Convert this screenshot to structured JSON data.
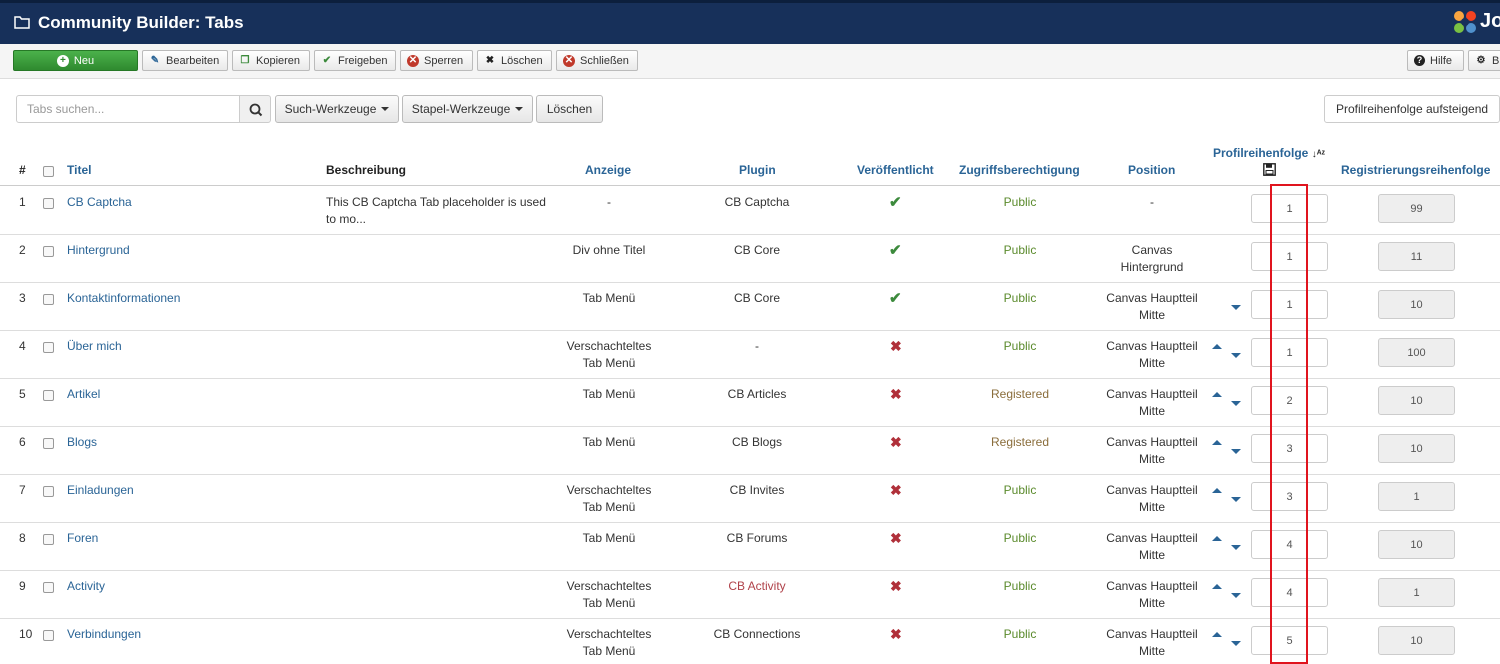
{
  "header": {
    "title": "Community Builder: Tabs",
    "logo_text": "Jo"
  },
  "toolbar": {
    "new_label": "Neu",
    "edit_label": "Bearbeiten",
    "copy_label": "Kopieren",
    "publish_label": "Freigeben",
    "block_label": "Sperren",
    "delete_label": "Löschen",
    "close_label": "Schließen",
    "help_label": "Hilfe",
    "options_label": "B"
  },
  "filters": {
    "search_placeholder": "Tabs suchen...",
    "search_tools_label": "Such-Werkzeuge",
    "batch_tools_label": "Stapel-Werkzeuge",
    "clear_label": "Löschen",
    "sort_label": "Profilreihenfolge aufsteigend"
  },
  "table": {
    "columns": {
      "num": "#",
      "title": "Titel",
      "description": "Beschreibung",
      "display": "Anzeige",
      "plugin": "Plugin",
      "published": "Veröffentlicht",
      "access": "Zugriffsberechtigung",
      "position": "Position",
      "profile_order": "Profilreihenfolge",
      "reg_order": "Registrierungsreihenfolge"
    },
    "rows": [
      {
        "num": "1",
        "title": "CB Captcha",
        "desc1": "This CB Captcha Tab placeholder is used",
        "desc2": "to mo...",
        "display1": "-",
        "display2": "",
        "plugin": "CB Captcha",
        "published": true,
        "access": "Public",
        "pos1": "-",
        "pos2": "",
        "order": "1",
        "reg": "99"
      },
      {
        "num": "2",
        "title": "Hintergrund",
        "desc1": "",
        "desc2": "",
        "display1": "Div ohne Titel",
        "display2": "",
        "plugin": "CB Core",
        "published": true,
        "access": "Public",
        "pos1": "Canvas",
        "pos2": "Hintergrund",
        "order": "1",
        "reg": "11"
      },
      {
        "num": "3",
        "title": "Kontaktinformationen",
        "desc1": "",
        "desc2": "",
        "display1": "Tab Menü",
        "display2": "",
        "plugin": "CB Core",
        "published": true,
        "access": "Public",
        "pos1": "Canvas Hauptteil",
        "pos2": "Mitte",
        "order": "1",
        "reg": "10"
      },
      {
        "num": "4",
        "title": "Über mich",
        "desc1": "",
        "desc2": "",
        "display1": "Verschachteltes",
        "display2": "Tab Menü",
        "plugin": "-",
        "published": false,
        "access": "Public",
        "pos1": "Canvas Hauptteil",
        "pos2": "Mitte",
        "order": "1",
        "reg": "100"
      },
      {
        "num": "5",
        "title": "Artikel",
        "desc1": "",
        "desc2": "",
        "display1": "Tab Menü",
        "display2": "",
        "plugin": "CB Articles",
        "published": false,
        "access": "Registered",
        "pos1": "Canvas Hauptteil",
        "pos2": "Mitte",
        "order": "2",
        "reg": "10"
      },
      {
        "num": "6",
        "title": "Blogs",
        "desc1": "",
        "desc2": "",
        "display1": "Tab Menü",
        "display2": "",
        "plugin": "CB Blogs",
        "published": false,
        "access": "Registered",
        "pos1": "Canvas Hauptteil",
        "pos2": "Mitte",
        "order": "3",
        "reg": "10"
      },
      {
        "num": "7",
        "title": "Einladungen",
        "desc1": "",
        "desc2": "",
        "display1": "Verschachteltes",
        "display2": "Tab Menü",
        "plugin": "CB Invites",
        "published": false,
        "access": "Public",
        "pos1": "Canvas Hauptteil",
        "pos2": "Mitte",
        "order": "3",
        "reg": "1"
      },
      {
        "num": "8",
        "title": "Foren",
        "desc1": "",
        "desc2": "",
        "display1": "Tab Menü",
        "display2": "",
        "plugin": "CB Forums",
        "published": false,
        "access": "Public",
        "pos1": "Canvas Hauptteil",
        "pos2": "Mitte",
        "order": "4",
        "reg": "10"
      },
      {
        "num": "9",
        "title": "Activity",
        "desc1": "",
        "desc2": "",
        "display1": "Verschachteltes",
        "display2": "Tab Menü",
        "plugin": "CB Activity",
        "published": false,
        "access": "Public",
        "pos1": "Canvas Hauptteil",
        "pos2": "Mitte",
        "order": "4",
        "reg": "1"
      },
      {
        "num": "10",
        "title": "Verbindungen",
        "desc1": "",
        "desc2": "",
        "display1": "Verschachteltes",
        "display2": "Tab Menü",
        "plugin": "CB Connections",
        "published": false,
        "access": "Public",
        "pos1": "Canvas Hauptteil",
        "pos2": "Mitte",
        "order": "5",
        "reg": "10"
      }
    ]
  },
  "colors": {
    "header_bg": "#17305a",
    "link": "#2a6496",
    "public": "#5a8a2b",
    "registered": "#8a6d3b",
    "highlight_frame": "#e0141e"
  }
}
